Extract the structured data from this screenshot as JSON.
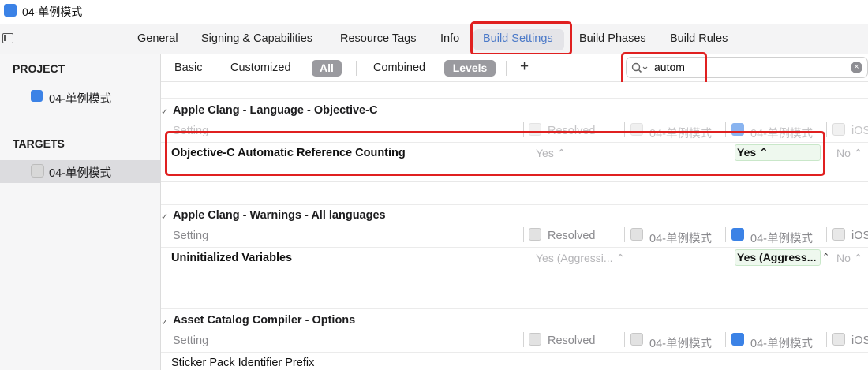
{
  "window": {
    "title": "04-单例模式"
  },
  "tabs": [
    {
      "label": "General"
    },
    {
      "label": "Signing & Capabilities"
    },
    {
      "label": "Resource Tags"
    },
    {
      "label": "Info"
    },
    {
      "label": "Build Settings",
      "selected": true
    },
    {
      "label": "Build Phases"
    },
    {
      "label": "Build Rules"
    }
  ],
  "sidebar": {
    "project_header": "PROJECT",
    "project_item": "04-单例模式",
    "targets_header": "TARGETS",
    "target_item": "04-单例模式"
  },
  "filter_bar": {
    "basic": "Basic",
    "customized": "Customized",
    "all": "All",
    "combined": "Combined",
    "levels": "Levels",
    "add": "+",
    "search_value": "autom",
    "clear": "×"
  },
  "sections": [
    {
      "title": "Apple Clang - Language - Objective-C",
      "columns": {
        "setting": "Setting",
        "resolved": "Resolved",
        "project": "04-单例模式",
        "target": "04-单例模式",
        "platform": "iOS"
      },
      "row": {
        "name": "Objective-C Automatic Reference Counting",
        "resolved": "Yes ⌃",
        "target": "Yes ⌃",
        "platform": "No ⌃"
      }
    },
    {
      "title": "Apple Clang - Warnings - All languages",
      "columns": {
        "setting": "Setting",
        "resolved": "Resolved",
        "project": "04-单例模式",
        "target": "04-单例模式",
        "platform": "iOS"
      },
      "row": {
        "name": "Uninitialized Variables",
        "resolved": "Yes (Aggressi... ⌃",
        "target": "Yes (Aggress...",
        "platform": "No ⌃"
      }
    },
    {
      "title": "Asset Catalog Compiler - Options",
      "columns": {
        "setting": "Setting",
        "resolved": "Resolved",
        "project": "04-单例模式",
        "target": "04-单例模式",
        "platform": "iOS"
      },
      "row": {
        "name": "Sticker Pack Identifier Prefix"
      }
    }
  ],
  "colors": {
    "accent": "#3b82e6",
    "highlight_red": "#e02020",
    "selected_tab_text": "#4b79c8"
  }
}
